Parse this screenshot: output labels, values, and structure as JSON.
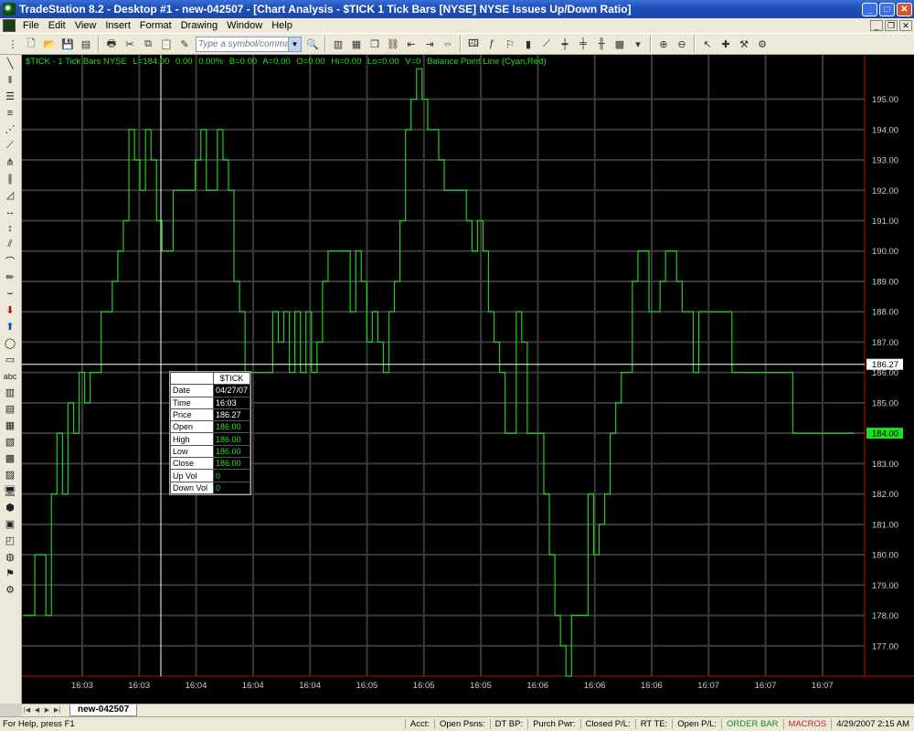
{
  "window": {
    "title": "TradeStation 8.2 - Desktop #1 - new-042507 - [Chart Analysis - $TICK  1 Tick Bars [NYSE] NYSE Issues Up/Down Ratio]"
  },
  "menu": [
    "File",
    "Edit",
    "View",
    "Insert",
    "Format",
    "Drawing",
    "Window",
    "Help"
  ],
  "toolbar": {
    "symbol_placeholder": "Type a symbol/command"
  },
  "infobar": {
    "symbol": "$TICK - 1 Tick Bars  NYSE",
    "last": "L=184.00",
    "change": "0.00",
    "pct": "0.00%",
    "bid": "B=0.00",
    "ask": "A=0.00",
    "open": "O=0.00",
    "hi": "Hi=0.00",
    "lo": "Lo=0.00",
    "vol": "V=0",
    "indicator": "Balance Point Line (Cyan,Red)"
  },
  "data_window": {
    "header": "$TICK",
    "rows": [
      {
        "label": "Date",
        "value": "04/27/07"
      },
      {
        "label": "Time",
        "value": "16:03"
      },
      {
        "label": "Price",
        "value": "186.27"
      },
      {
        "label": "Open",
        "value": "186.00"
      },
      {
        "label": "High",
        "value": "186.00"
      },
      {
        "label": "Low",
        "value": "186.00"
      },
      {
        "label": "Close",
        "value": "186.00"
      },
      {
        "label": "Up Vol",
        "value": "0"
      },
      {
        "label": "Down Vol",
        "value": "0"
      }
    ]
  },
  "chart_data": {
    "type": "line",
    "title": "$TICK - 1 Tick Bars  NYSE",
    "ylim": [
      176.0,
      196.1
    ],
    "yticks": [
      177,
      178,
      179,
      180,
      181,
      182,
      183,
      184,
      185,
      186,
      187,
      188,
      189,
      190,
      191,
      192,
      193,
      194,
      195
    ],
    "ytick_labels": [
      "177.00",
      "178.00",
      "179.00",
      "180.00",
      "181.00",
      "182.00",
      "183.00",
      "184.00",
      "185.00",
      "186.00",
      "187.00",
      "188.00",
      "189.00",
      "190.00",
      "191.00",
      "192.00",
      "193.00",
      "194.00",
      "195.00"
    ],
    "xtick_labels": [
      "16:03",
      "16:03",
      "16:04",
      "16:04",
      "16:04",
      "16:05",
      "16:05",
      "16:05",
      "16:06",
      "16:06",
      "16:06",
      "16:07",
      "16:07",
      "16:07"
    ],
    "series": [
      {
        "color": "#22cc22",
        "values": [
          178,
          178,
          180,
          180,
          178,
          182,
          184,
          182,
          185,
          184,
          186,
          185,
          186,
          186,
          188,
          188,
          189,
          190,
          191,
          194,
          193,
          192,
          194,
          193,
          191,
          190,
          190,
          192,
          192,
          192,
          192,
          193,
          194,
          192,
          192,
          194,
          193,
          192,
          189,
          188,
          186,
          186,
          186,
          186,
          186,
          188,
          187,
          188,
          186,
          188,
          186,
          188,
          186,
          187,
          189,
          190,
          190,
          190,
          190,
          188,
          190,
          189,
          187,
          188,
          187,
          186,
          188,
          189,
          191,
          194,
          195,
          196,
          195,
          194,
          194,
          193,
          192,
          192,
          192,
          192,
          191,
          190,
          191,
          190,
          188,
          187,
          186,
          184,
          184,
          188,
          187,
          184,
          184,
          184,
          182,
          180,
          178,
          177,
          176,
          178,
          178,
          178,
          182,
          180,
          181,
          182,
          184,
          185,
          186,
          186,
          189,
          190,
          190,
          188,
          188,
          189,
          190,
          190,
          189,
          188,
          188,
          186,
          188,
          188,
          188,
          188,
          188,
          188,
          186,
          186,
          186,
          186,
          186,
          186,
          186,
          186,
          186,
          186,
          186,
          184,
          184,
          184,
          184,
          184,
          184,
          184,
          184,
          184,
          184,
          184,
          184
        ]
      },
      {
        "color": "#ffffff",
        "values": [
          186.27
        ]
      }
    ],
    "last_price_label": "184.00",
    "crosshair_label": "186.27",
    "grid": true
  },
  "tab": {
    "label": "new-042507"
  },
  "status": {
    "help": "For Help, press F1",
    "acct": "Acct:",
    "open_psns": "Open Psns:",
    "dt_bp": "DT BP:",
    "purch_pwr": "Purch Pwr:",
    "closed_pl": "Closed P/L:",
    "rt_te": "RT TE:",
    "open_pl": "Open P/L:",
    "order_bar": "ORDER BAR",
    "macros": "MACROS",
    "datetime": "4/29/2007 2:15 AM"
  },
  "colors": {
    "background": "#000000",
    "grid": "#3a3a3a",
    "series": "#22cc22",
    "axis_border": "#cc0000",
    "crosshair": "#ffffff"
  }
}
